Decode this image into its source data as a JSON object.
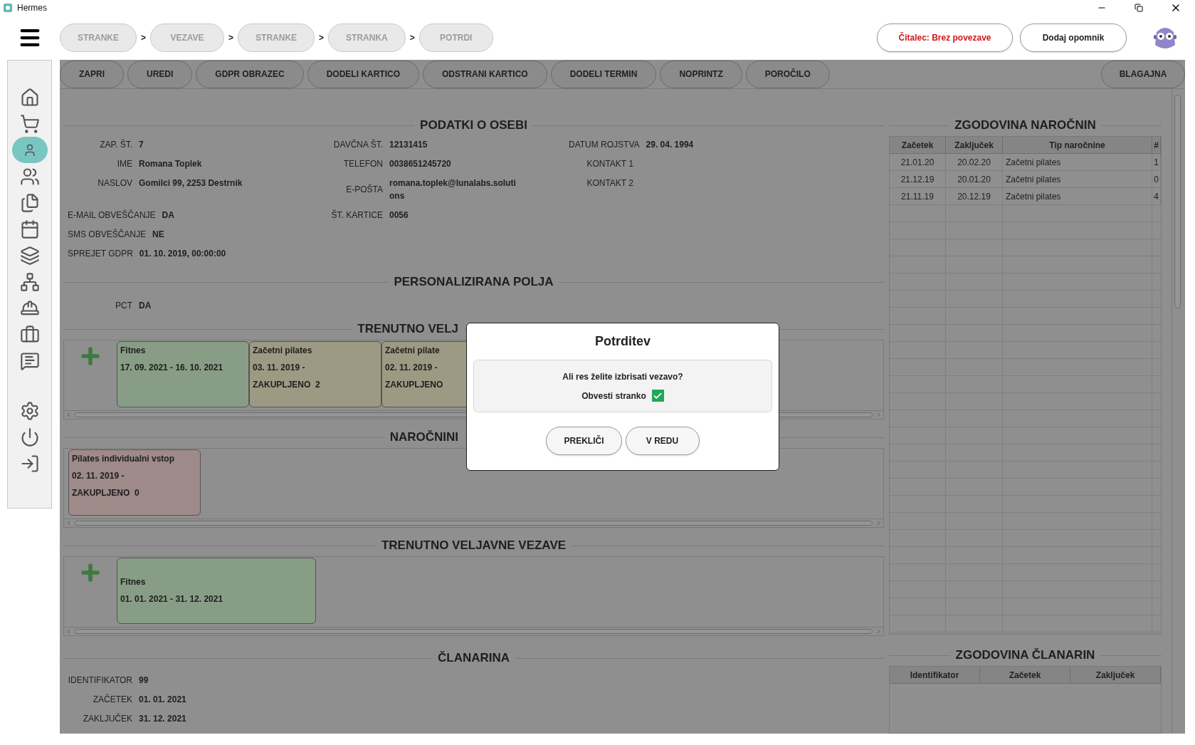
{
  "window": {
    "title": "Hermes"
  },
  "breadcrumbs": [
    {
      "label": "STRANKE",
      "separator": ">"
    },
    {
      "label": "VEZAVE",
      "separator": ">"
    },
    {
      "label": "STRANKE",
      "separator": ">"
    },
    {
      "label": "STRANKA",
      "separator": ">"
    },
    {
      "label": "POTRDI"
    }
  ],
  "reader_button": "Čitalec: Brez povezave",
  "reminder_button": "Dodaj opomnik",
  "sidebar": {
    "items": [
      {
        "selected": false
      },
      {
        "selected": false
      },
      {
        "selected": true
      },
      {
        "selected": false
      },
      {
        "selected": false
      },
      {
        "selected": false
      },
      {
        "selected": false
      },
      {
        "selected": false
      },
      {
        "selected": false
      },
      {
        "selected": false
      },
      {
        "selected": false
      },
      {
        "selected": false
      },
      {
        "selected": false
      },
      {
        "selected": false
      }
    ]
  },
  "toolbar": {
    "left": [
      "ZAPRI",
      "UREDI",
      "GDPR OBRAZEC",
      "DODELI KARTICO",
      "ODSTRANI KARTICO",
      "DODELI TERMIN",
      "NOPRINTZ",
      "POROČILO"
    ],
    "right": [
      "BLAGAJNA"
    ]
  },
  "person": {
    "title": "PODATKI O OSEBI",
    "rows": [
      [
        {
          "label": "ZAP. ŠT.",
          "value": [
            "7"
          ]
        },
        {
          "label": "DAVČNA ŠT.",
          "value": [
            "12131415"
          ]
        },
        {
          "label": "DATUM ROJSTVA",
          "value": [
            "29. 04. 1994"
          ]
        }
      ],
      [
        {
          "label": "IME",
          "value": [
            "Romana Toplek"
          ]
        },
        {
          "label": "TELEFON",
          "value": [
            "0038651245720"
          ]
        },
        {
          "label": "KONTAKT 1"
        }
      ],
      [
        {
          "label": "NASLOV",
          "value": [
            "Gomilci 99, 2253 Destrnik"
          ]
        },
        {
          "label": "E-POŠTA",
          "value": [
            "romana.toplek@lunalabs.soluti",
            "ons"
          ]
        },
        {
          "label": "KONTAKT 2"
        }
      ],
      [
        {
          "label": "E-MAIL OBVEŠČANJE",
          "value": [
            "DA"
          ]
        },
        {
          "label": "ŠT. KARTICE",
          "value": [
            "0056"
          ]
        }
      ],
      [
        {
          "label": "SMS OBVEŠČANJE",
          "value": [
            "NE"
          ]
        }
      ],
      [
        {
          "label": "SPREJET GDPR",
          "value": [
            "01. 10. 2019, 00:00:00"
          ]
        }
      ]
    ]
  },
  "custom_fields": {
    "title": "PERSONALIZIRANA POLJA",
    "fields": [
      {
        "label": "PCT",
        "value": "DA"
      }
    ]
  },
  "current_subscriptions": {
    "title": "TRENUTNO VELJ",
    "cards": [
      {
        "color": "#889d86",
        "lines": [
          "Fitnes",
          "17. 09. 2021 - 16. 10. 2021"
        ]
      },
      {
        "color": "#9c9a83",
        "lines": [
          "Začetni pilates",
          "03. 11. 2019 -",
          "ZAKUPLJENO  2"
        ]
      },
      {
        "color": "#9c9a83",
        "lines": [
          "Začetni pilate",
          "02. 11. 2019 -",
          "ZAKUPLJENO"
        ]
      }
    ]
  },
  "subscriptions": {
    "title": "NAROČNINI",
    "cards": [
      {
        "color": "#9e8a88",
        "lines": [
          "Pilates individualni vstop",
          "02. 11. 2019 -",
          "ZAKUPLJENO  0"
        ]
      }
    ]
  },
  "current_links": {
    "title": "TRENUTNO VELJAVNE VEZAVE",
    "cards": [
      {
        "color": "#889d86",
        "lines": [
          "Fitnes",
          "01. 01. 2021 - 31. 12. 2021"
        ]
      }
    ]
  },
  "membership": {
    "title": "ČLANARINA",
    "fields": [
      {
        "label": "IDENTIFIKATOR",
        "value": "99"
      },
      {
        "label": "ZAČETEK",
        "value": "01. 01. 2021"
      },
      {
        "label": "ZAKLJUČEK",
        "value": "31. 12. 2021"
      }
    ]
  },
  "subscription_history": {
    "title": "ZGODOVINA NAROČNIN",
    "columns": [
      "Začetek",
      "Zaključek",
      "Tip naročnine",
      "#"
    ],
    "rows": [
      [
        "21.01.20",
        "20.02.20",
        "Začetni pilates",
        "1"
      ],
      [
        "21.12.19",
        "20.01.20",
        "Začetni pilates",
        "0"
      ],
      [
        "21.11.19",
        "20.12.19",
        "Začetni pilates",
        "4"
      ]
    ]
  },
  "membership_history": {
    "title": "ZGODOVINA ČLANARIN",
    "columns": [
      "Identifikator",
      "Začetek",
      "Zaključek"
    ]
  },
  "dialog": {
    "title": "Potrditev",
    "message": "Ali res želite izbrisati vezavo?",
    "notify": {
      "label": "Obvesti stranko",
      "checked": true
    },
    "buttons": [
      "PREKLIČI",
      "V REDU"
    ]
  }
}
